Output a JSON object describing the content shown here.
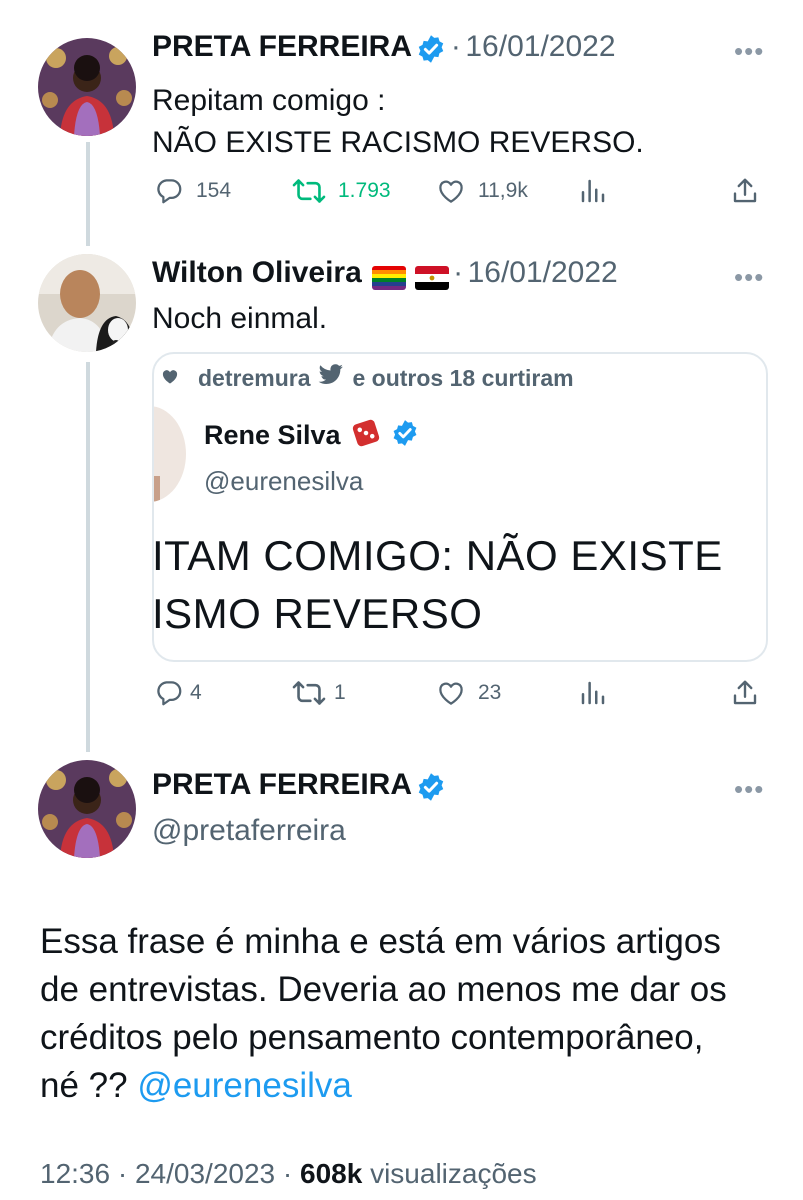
{
  "tweet1": {
    "name": "PRETA FERREIRA",
    "date": "16/01/2022",
    "sep": "·",
    "text_line1": "Repitam comigo :",
    "text_line2": "NÃO EXISTE RACISMO REVERSO.",
    "replies": "154",
    "retweets": "1.793",
    "likes": "11,9k"
  },
  "tweet2": {
    "name": "Wilton Oliveira",
    "date": "16/01/2022",
    "sep": "·",
    "text": "Noch einmal.",
    "replies": "4",
    "retweets": "1",
    "likes": "23",
    "quote": {
      "liked_by_user": "detremura",
      "liked_by_suffix": "e outros 18 curtiram",
      "name": "Rene Silva",
      "handle": "@eurenesilva",
      "line1": "ITAM COMIGO: NÃO EXISTE",
      "line2": "ISMO REVERSO"
    }
  },
  "main": {
    "name": "PRETA FERREIRA",
    "handle": "@pretaferreira",
    "line1": "Essa frase é minha e está em vários artigos",
    "line2": "de entrevistas. Deveria ao menos me dar os",
    "line3": "créditos pelo pensamento contemporâneo,",
    "line4_prefix": "né ?? ",
    "mention": "@eurenesilva",
    "time": "12:36",
    "date": "24/03/2023",
    "sep": "·",
    "views_count": "608k",
    "views_label": "visualizações"
  },
  "colors": {
    "verified": "#1d9bf0",
    "retweet_green": "#00ba7c",
    "text_secondary": "#536471",
    "link": "#1d9bf0"
  },
  "icons": [
    "reply-icon",
    "retweet-icon",
    "like-icon",
    "views-icon",
    "share-icon",
    "verified-icon",
    "more-icon",
    "bird-icon",
    "heart-small-icon",
    "dice-emoji",
    "rainbow-flag",
    "egypt-flag"
  ]
}
